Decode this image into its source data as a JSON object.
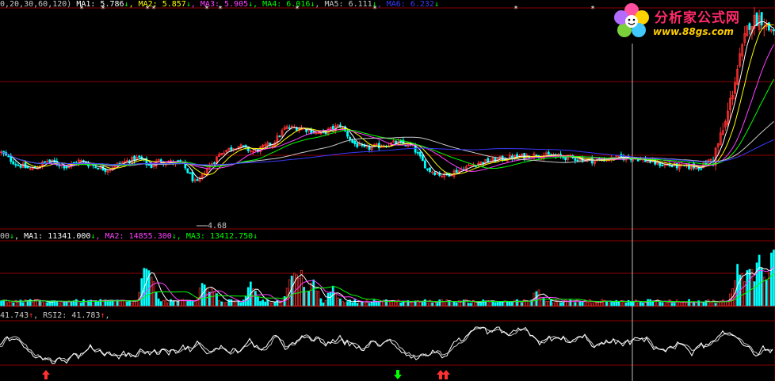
{
  "colors": {
    "background": "#000000",
    "ma1": "#ffffff",
    "ma2": "#ffff00",
    "ma3": "#ff40ff",
    "ma4": "#00ff00",
    "ma5": "#c8c8c8",
    "ma6": "#3a3aff",
    "up": "#ff3030",
    "down": "#00ffff",
    "divider": "#8b0000",
    "text": "#c8c8c8"
  },
  "logo": {
    "title": "分析家公式网",
    "url": "www.88gs.com",
    "flower_icon": "flower-icon"
  },
  "price_panel": {
    "legend": [
      {
        "text": "0,20,30,60,120)",
        "color": "#c8c8c8"
      },
      {
        "text": " MA1: 5.786",
        "color": "#ffffff"
      },
      {
        "text": "↓",
        "color": "#00ff00"
      },
      {
        "text": ", MA2: 5.857",
        "color": "#ffff00"
      },
      {
        "text": "↓",
        "color": "#00ff00"
      },
      {
        "text": ", MA3: 5.905",
        "color": "#ff40ff"
      },
      {
        "text": "↓",
        "color": "#00ff00"
      },
      {
        "text": ", MA4: 6.016",
        "color": "#00ff00"
      },
      {
        "text": "↓",
        "color": "#00ff00"
      },
      {
        "text": ", MA5: 6.111",
        "color": "#c8c8c8"
      },
      {
        "text": "↓",
        "color": "#00ff00"
      },
      {
        "text": ", MA6: 6.232",
        "color": "#3a3aff"
      },
      {
        "text": "↓",
        "color": "#00ff00"
      }
    ],
    "low_label": "4.68"
  },
  "volume_panel": {
    "legend": [
      {
        "text": "00",
        "color": "#c8c8c8"
      },
      {
        "text": "↓",
        "color": "#00ff00"
      },
      {
        "text": ", MA1: 11341.000",
        "color": "#ffffff"
      },
      {
        "text": "↓",
        "color": "#00ff00"
      },
      {
        "text": ", MA2: 14855.300",
        "color": "#ff40ff"
      },
      {
        "text": "↓",
        "color": "#00ff00"
      },
      {
        "text": ", MA3: 13412.750",
        "color": "#00ff00"
      },
      {
        "text": "↓",
        "color": "#00ff00"
      }
    ]
  },
  "rsi_panel": {
    "legend": [
      {
        "text": "41.743",
        "color": "#c8c8c8"
      },
      {
        "text": "↑",
        "color": "#ff3030"
      },
      {
        "text": ", RSI2: 41.783",
        "color": "#c8c8c8"
      },
      {
        "text": "↑",
        "color": "#ff3030"
      },
      {
        "text": ",",
        "color": "#c8c8c8"
      }
    ]
  },
  "chart_data": [
    {
      "type": "candlestick",
      "panel": "price",
      "bars": 320,
      "price_range": [
        4.2,
        7.8
      ],
      "low_marker": 4.68,
      "segments": [
        [
          0,
          5.45
        ],
        [
          20,
          5.25
        ],
        [
          40,
          5.15
        ],
        [
          60,
          5.3
        ],
        [
          85,
          5.2
        ],
        [
          100,
          5.3
        ],
        [
          110,
          5.25
        ],
        [
          135,
          5.15
        ],
        [
          150,
          5.25
        ],
        [
          175,
          5.35
        ],
        [
          190,
          5.2
        ],
        [
          200,
          5.3
        ],
        [
          230,
          5.25
        ],
        [
          248,
          4.9
        ],
        [
          260,
          5.15
        ],
        [
          280,
          5.45
        ],
        [
          300,
          5.55
        ],
        [
          320,
          5.45
        ],
        [
          345,
          5.6
        ],
        [
          360,
          5.85
        ],
        [
          380,
          5.85
        ],
        [
          405,
          5.75
        ],
        [
          430,
          5.9
        ],
        [
          445,
          5.6
        ],
        [
          460,
          5.5
        ],
        [
          480,
          5.55
        ],
        [
          500,
          5.6
        ],
        [
          520,
          5.55
        ],
        [
          540,
          5.15
        ],
        [
          560,
          5.05
        ],
        [
          580,
          5.15
        ],
        [
          600,
          5.25
        ],
        [
          640,
          5.35
        ],
        [
          680,
          5.4
        ],
        [
          720,
          5.35
        ],
        [
          750,
          5.3
        ],
        [
          780,
          5.35
        ],
        [
          800,
          5.35
        ],
        [
          830,
          5.25
        ],
        [
          860,
          5.2
        ],
        [
          885,
          5.2
        ],
        [
          900,
          5.35
        ],
        [
          915,
          5.9
        ],
        [
          930,
          6.8
        ],
        [
          945,
          7.6
        ],
        [
          960,
          7.7
        ],
        [
          970,
          7.5
        ]
      ],
      "moving_averages": [
        "MA1",
        "MA2",
        "MA3",
        "MA4",
        "MA5",
        "MA6"
      ]
    },
    {
      "type": "bar",
      "panel": "volume",
      "bars": 320,
      "spikes": [
        [
          185,
          0.85
        ],
        [
          190,
          0.55
        ],
        [
          258,
          0.5
        ],
        [
          268,
          0.35
        ],
        [
          318,
          0.45
        ],
        [
          370,
          0.8
        ],
        [
          378,
          0.75
        ],
        [
          395,
          0.5
        ],
        [
          420,
          0.35
        ],
        [
          678,
          0.3
        ],
        [
          932,
          0.85
        ],
        [
          945,
          0.95
        ],
        [
          958,
          0.9
        ],
        [
          975,
          1.0
        ]
      ],
      "moving_averages": [
        "MA1",
        "MA2",
        "MA3"
      ]
    },
    {
      "type": "line",
      "panel": "rsi",
      "series": [
        "RSI1",
        "RSI2"
      ],
      "markers": [
        {
          "x": 58,
          "kind": "up"
        },
        {
          "x": 502,
          "kind": "down"
        },
        {
          "x": 556,
          "kind": "up"
        },
        {
          "x": 563,
          "kind": "up"
        }
      ]
    }
  ]
}
